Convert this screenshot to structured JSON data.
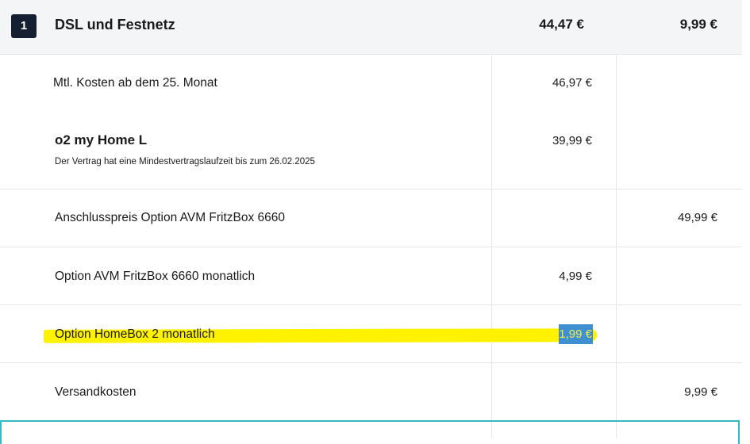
{
  "header": {
    "index": "1",
    "title": "DSL und Festnetz",
    "monthly_total": "44,47 €",
    "onetime_total": "9,99 €"
  },
  "rows": {
    "mtl_kosten": {
      "label": "Mtl. Kosten ab dem 25. Monat",
      "monthly": "46,97 €"
    },
    "tariff": {
      "name": "o2 my Home L",
      "note": "Der Vertrag hat eine Mindestvertragslaufzeit bis zum 26.02.2025",
      "monthly": "39,99 €"
    },
    "anschluss": {
      "label": "Anschlusspreis Option AVM FritzBox 6660",
      "onetime": "49,99 €"
    },
    "fritzbox": {
      "label": "Option AVM FritzBox 6660 monatlich",
      "monthly": "4,99 €"
    },
    "homebox": {
      "label": "Option HomeBox 2 monatlich",
      "monthly": "1,99 €"
    },
    "versand": {
      "label": "Versandkosten",
      "onetime": "9,99 €"
    }
  },
  "colors": {
    "badge": "#142032",
    "highlight": "#fff200",
    "selection": "#3f8fd1",
    "teal_border": "#35b9c6"
  }
}
